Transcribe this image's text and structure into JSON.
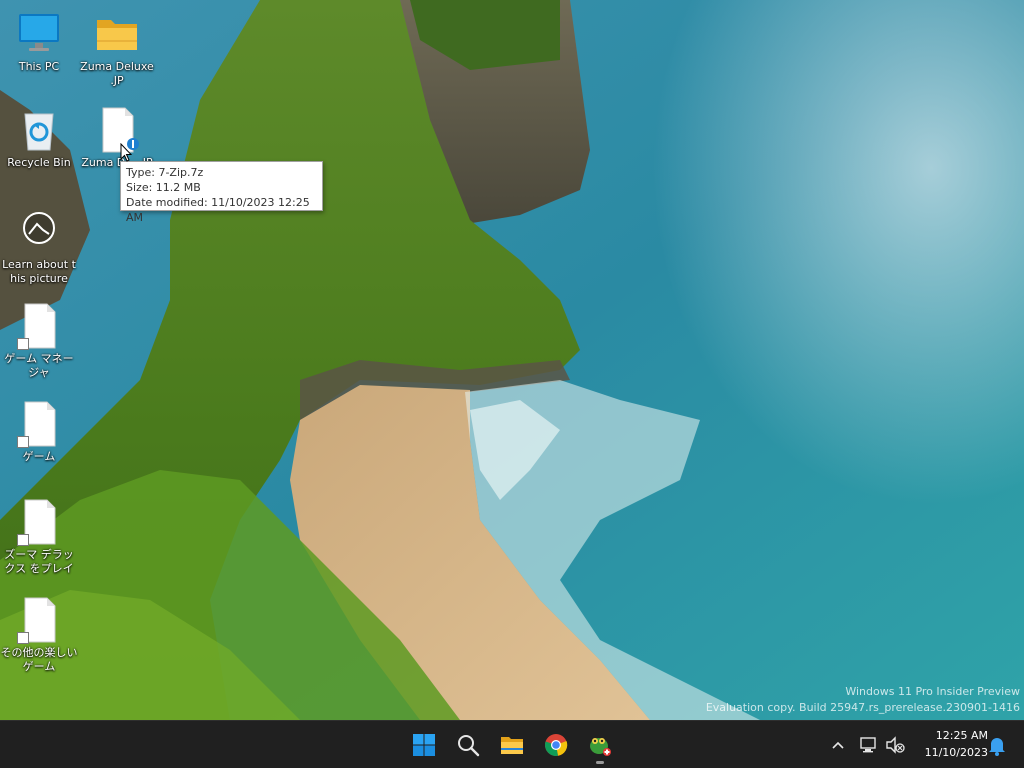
{
  "desktop_icons": [
    {
      "label": "This PC",
      "icon": "monitor-icon"
    },
    {
      "label": "Zuma Deluxe .JP",
      "icon": "folder-icon"
    },
    {
      "label": "Recycle Bin",
      "icon": "recycle-bin-icon"
    },
    {
      "label": "Zuma D... .JP",
      "icon": "archive-file-icon"
    },
    {
      "label": "Learn about this picture",
      "icon": "camera-icon"
    },
    {
      "label": "ゲーム マネージャ",
      "icon": "file-shortcut-icon"
    },
    {
      "label": "ゲーム",
      "icon": "file-shortcut-icon"
    },
    {
      "label": "ズーマ デラックス をプレイ",
      "icon": "file-shortcut-icon"
    },
    {
      "label": "その他の楽しい ゲーム",
      "icon": "file-shortcut-icon"
    }
  ],
  "tooltip": {
    "type": "Type: 7-Zip.7z",
    "size": "Size: 11.2 MB",
    "date": "Date modified: 11/10/2023 12:25 AM"
  },
  "watermark": {
    "line1": "Windows 11 Pro Insider Preview",
    "line2": "Evaluation copy. Build 25947.rs_prerelease.230901-1416"
  },
  "taskbar": {
    "apps": [
      {
        "name": "Start",
        "icon": "windows-start-icon"
      },
      {
        "name": "Search",
        "icon": "search-icon"
      },
      {
        "name": "File Explorer",
        "icon": "file-explorer-icon"
      },
      {
        "name": "Google Chrome",
        "icon": "chrome-icon"
      },
      {
        "name": "Zuma Deluxe",
        "icon": "zuma-frog-icon"
      }
    ],
    "tray": {
      "clock_time": "12:25 AM",
      "clock_date": "11/10/2023"
    }
  },
  "colors": {
    "taskbar_bg": "#202020",
    "accent": "#0078d4",
    "tooltip_bg": "#ffffff"
  }
}
